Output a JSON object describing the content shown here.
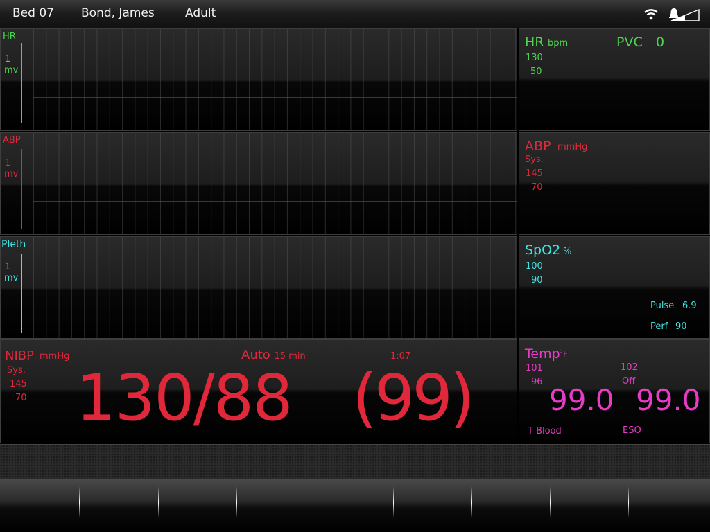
{
  "header": {
    "bed": "Bed 07",
    "patient": "Bond, James",
    "category": "Adult"
  },
  "icons": {
    "wifi": "wifi-icon",
    "alarm": "alarm-bell-icon",
    "signal": "signal-strength-icon"
  },
  "waves": {
    "hr": {
      "label": "HR",
      "scale_value": "1",
      "scale_unit": "mv",
      "color": "#4dd64d"
    },
    "abp": {
      "label": "ABP",
      "scale_value": "1",
      "scale_unit": "mv",
      "color": "#e0283a"
    },
    "pleth": {
      "label": "Pleth",
      "scale_value": "1",
      "scale_unit": "mv",
      "color": "#3fe4e4"
    }
  },
  "hr_panel": {
    "title": "HR",
    "unit": "bpm",
    "pvc_label": "PVC",
    "pvc_value": "0",
    "limit_high": "130",
    "limit_low": "50"
  },
  "abp_panel": {
    "title": "ABP",
    "unit": "mmHg",
    "mode": "Sys.",
    "limit_high": "145",
    "limit_low": "70"
  },
  "spo2_panel": {
    "title": "SpO2",
    "unit": "%",
    "limit_high": "100",
    "limit_low": "90",
    "pulse_label": "Pulse",
    "pulse_value": "6.9",
    "perf_label": "Perf",
    "perf_value": "90"
  },
  "nibp": {
    "title": "NIBP",
    "unit": "mmHg",
    "mode": "Sys.",
    "limit_high": "145",
    "limit_low": "70",
    "auto_label": "Auto",
    "auto_interval": "15 min",
    "timer": "1:07",
    "reading": "130/88",
    "mean": "(99)"
  },
  "temp": {
    "title": "Temp",
    "unit": "°F",
    "t1_limit_high": "101",
    "t1_limit_low": "96",
    "t2_limit_high": "102",
    "t2_limit_low": "Off",
    "t1_value": "99.0",
    "t2_value": "99.0",
    "t1_label": "T Blood",
    "t2_label": "ESO"
  }
}
